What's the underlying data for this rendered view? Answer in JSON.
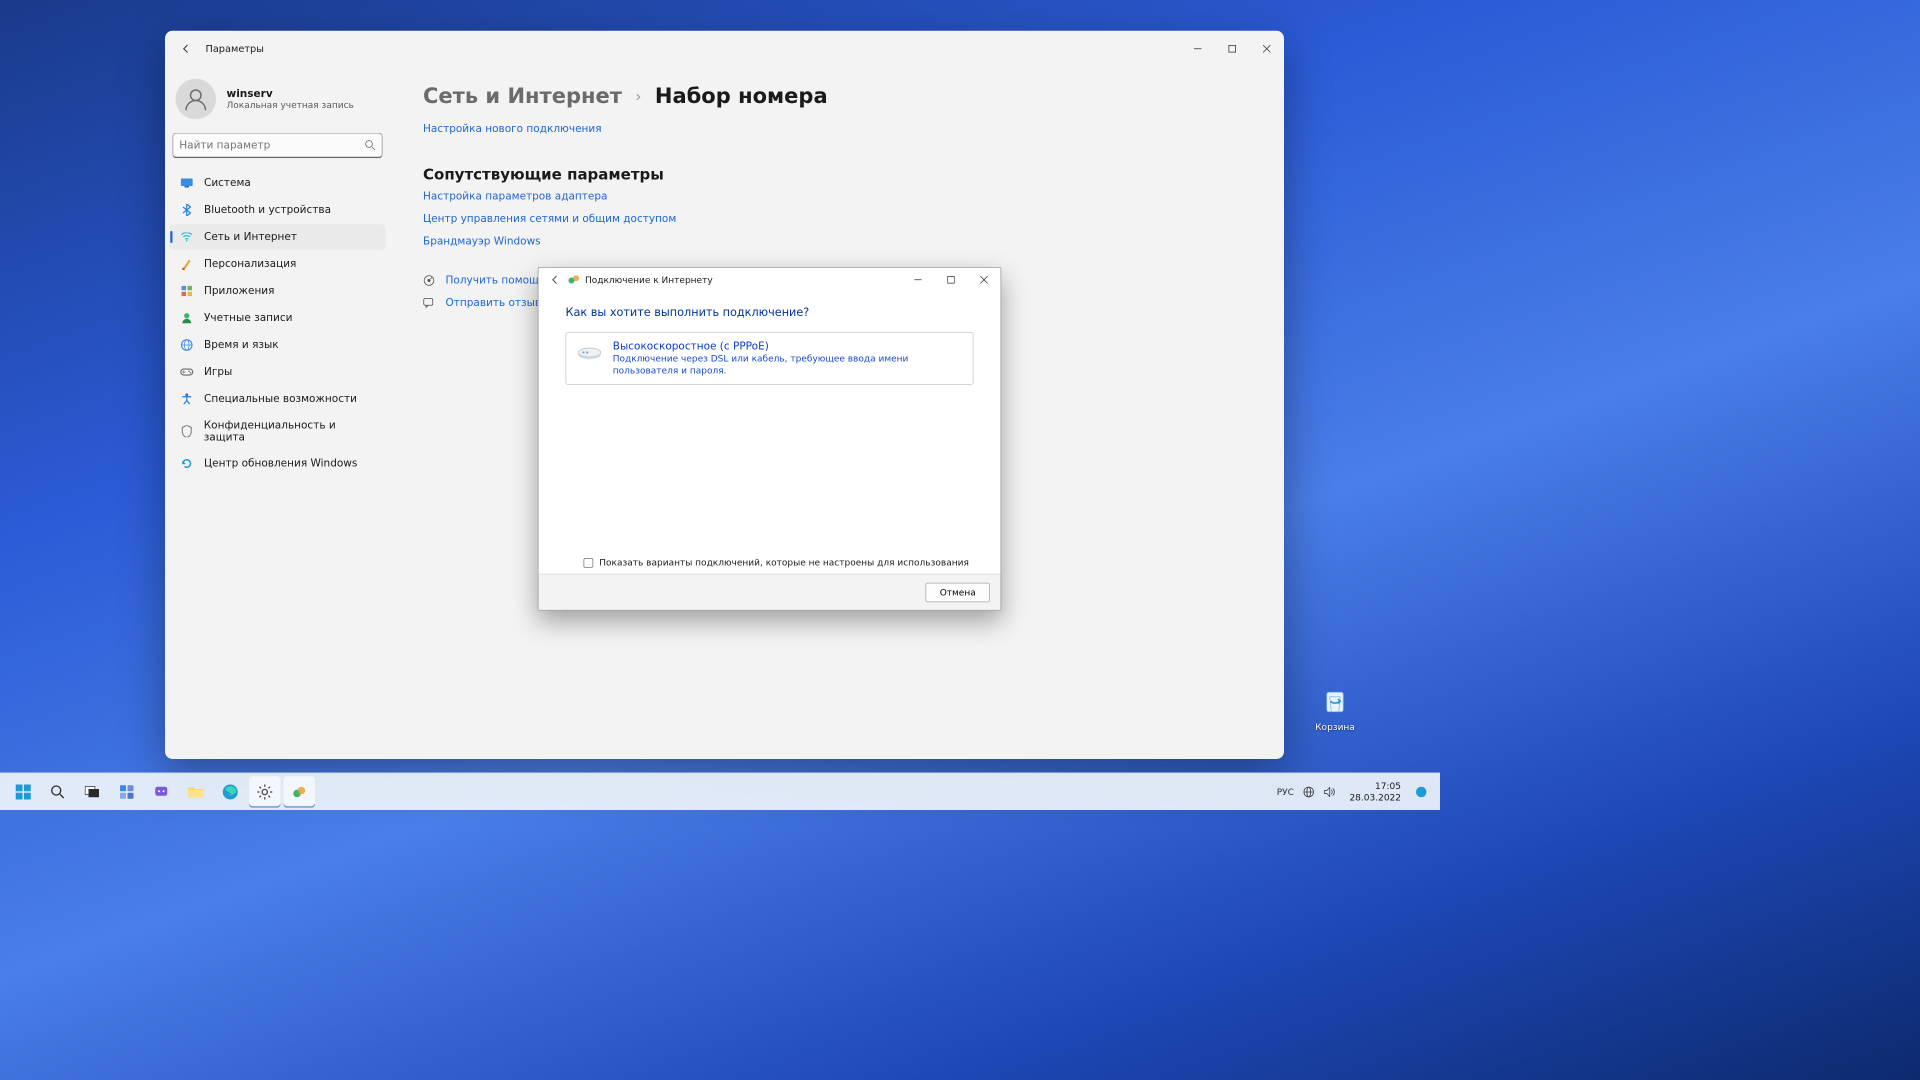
{
  "desktop": {
    "recycle_bin": "Корзина"
  },
  "settings_window": {
    "title": "Параметры",
    "account": {
      "name": "winserv",
      "subtitle": "Локальная учетная запись"
    },
    "search_placeholder": "Найти параметр",
    "sidebar": {
      "items": [
        {
          "label": "Система"
        },
        {
          "label": "Bluetooth и устройства"
        },
        {
          "label": "Сеть и Интернет"
        },
        {
          "label": "Персонализация"
        },
        {
          "label": "Приложения"
        },
        {
          "label": "Учетные записи"
        },
        {
          "label": "Время и язык"
        },
        {
          "label": "Игры"
        },
        {
          "label": "Специальные возможности"
        },
        {
          "label": "Конфиденциальность и защита"
        },
        {
          "label": "Центр обновления Windows"
        }
      ]
    },
    "breadcrumb": {
      "root": "Сеть и Интернет",
      "current": "Набор номера"
    },
    "new_connection_link": "Настройка нового подключения",
    "related_header": "Сопутствующие параметры",
    "related_links": {
      "adapter": "Настройка параметров адаптера",
      "sharing_center": "Центр управления сетями и общим доступом",
      "firewall": "Брандмауэр Windows"
    },
    "help_link": "Получить помощь",
    "feedback_link": "Отправить отзыв"
  },
  "wizard": {
    "title": "Подключение к Интернету",
    "heading": "Как вы хотите выполнить подключение?",
    "option": {
      "title": "Высокоскоростное (с PPPoE)",
      "desc": "Подключение через DSL или кабель, требующее ввода имени пользователя и пароля."
    },
    "show_unconfigured": "Показать варианты подключений, которые не настроены для использования",
    "cancel": "Отмена"
  },
  "taskbar": {
    "lang": "РУС",
    "time": "17:05",
    "date": "28.03.2022"
  }
}
